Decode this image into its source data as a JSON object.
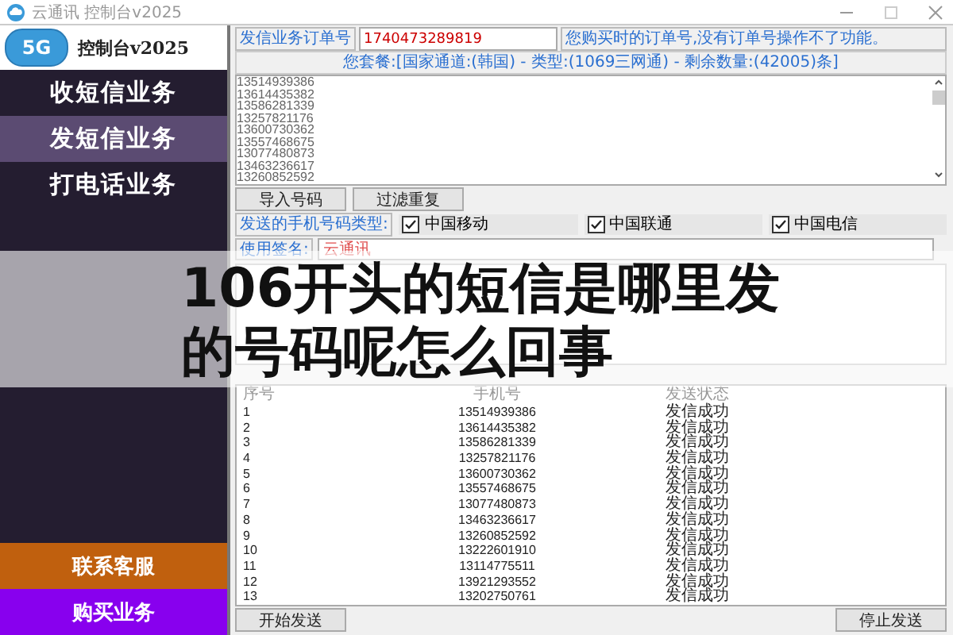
{
  "window": {
    "title": "云通讯 控制台v2025"
  },
  "sidebar": {
    "logo_badge": "5G",
    "logo_title": "控制台v2025",
    "items": [
      {
        "label": "收短信业务",
        "selected": false
      },
      {
        "label": "发短信业务",
        "selected": true
      },
      {
        "label": "打电话业务",
        "selected": false
      }
    ],
    "bottom_buttons": [
      {
        "label": "联系客服",
        "color": "#c0600e"
      },
      {
        "label": "购买业务",
        "color": "#8800ee"
      }
    ]
  },
  "order": {
    "label": "发信业务订单号",
    "value": "1740473289819",
    "hint": "您购买时的订单号,没有订单号操作不了功能。"
  },
  "package_info": "您套餐:[国家通道:(韩国) - 类型:(1069三网通) - 剩余数量:(42005)条]",
  "numbers": [
    "13514939386",
    "13614435382",
    "13586281339",
    "13257821176",
    "13600730362",
    "13557468675",
    "13077480873",
    "13463236617",
    "13260852592"
  ],
  "number_buttons": [
    "导入号码",
    "过滤重复"
  ],
  "carrier_label": "发送的手机号码类型:",
  "carriers": [
    {
      "label": "中国移动",
      "checked": true
    },
    {
      "label": "中国联通",
      "checked": true
    },
    {
      "label": "中国电信",
      "checked": true
    }
  ],
  "signature": {
    "label": "使用签名:",
    "value": "云通讯"
  },
  "table": {
    "columns": [
      "序号",
      "手机号",
      "发送状态"
    ],
    "rows": [
      [
        "1",
        "13514939386",
        "发信成功"
      ],
      [
        "2",
        "13614435382",
        "发信成功"
      ],
      [
        "3",
        "13586281339",
        "发信成功"
      ],
      [
        "4",
        "13257821176",
        "发信成功"
      ],
      [
        "5",
        "13600730362",
        "发信成功"
      ],
      [
        "6",
        "13557468675",
        "发信成功"
      ],
      [
        "7",
        "13077480873",
        "发信成功"
      ],
      [
        "8",
        "13463236617",
        "发信成功"
      ],
      [
        "9",
        "13260852592",
        "发信成功"
      ],
      [
        "10",
        "13222601910",
        "发信成功"
      ],
      [
        "11",
        "13114775511",
        "发信成功"
      ],
      [
        "12",
        "13921293552",
        "发信成功"
      ],
      [
        "13",
        "13202750761",
        "发信成功"
      ]
    ]
  },
  "footer_buttons": [
    "开始发送",
    "停止发送"
  ],
  "overlay_caption": "106开头的短信是哪里发的号码呢怎么回事"
}
